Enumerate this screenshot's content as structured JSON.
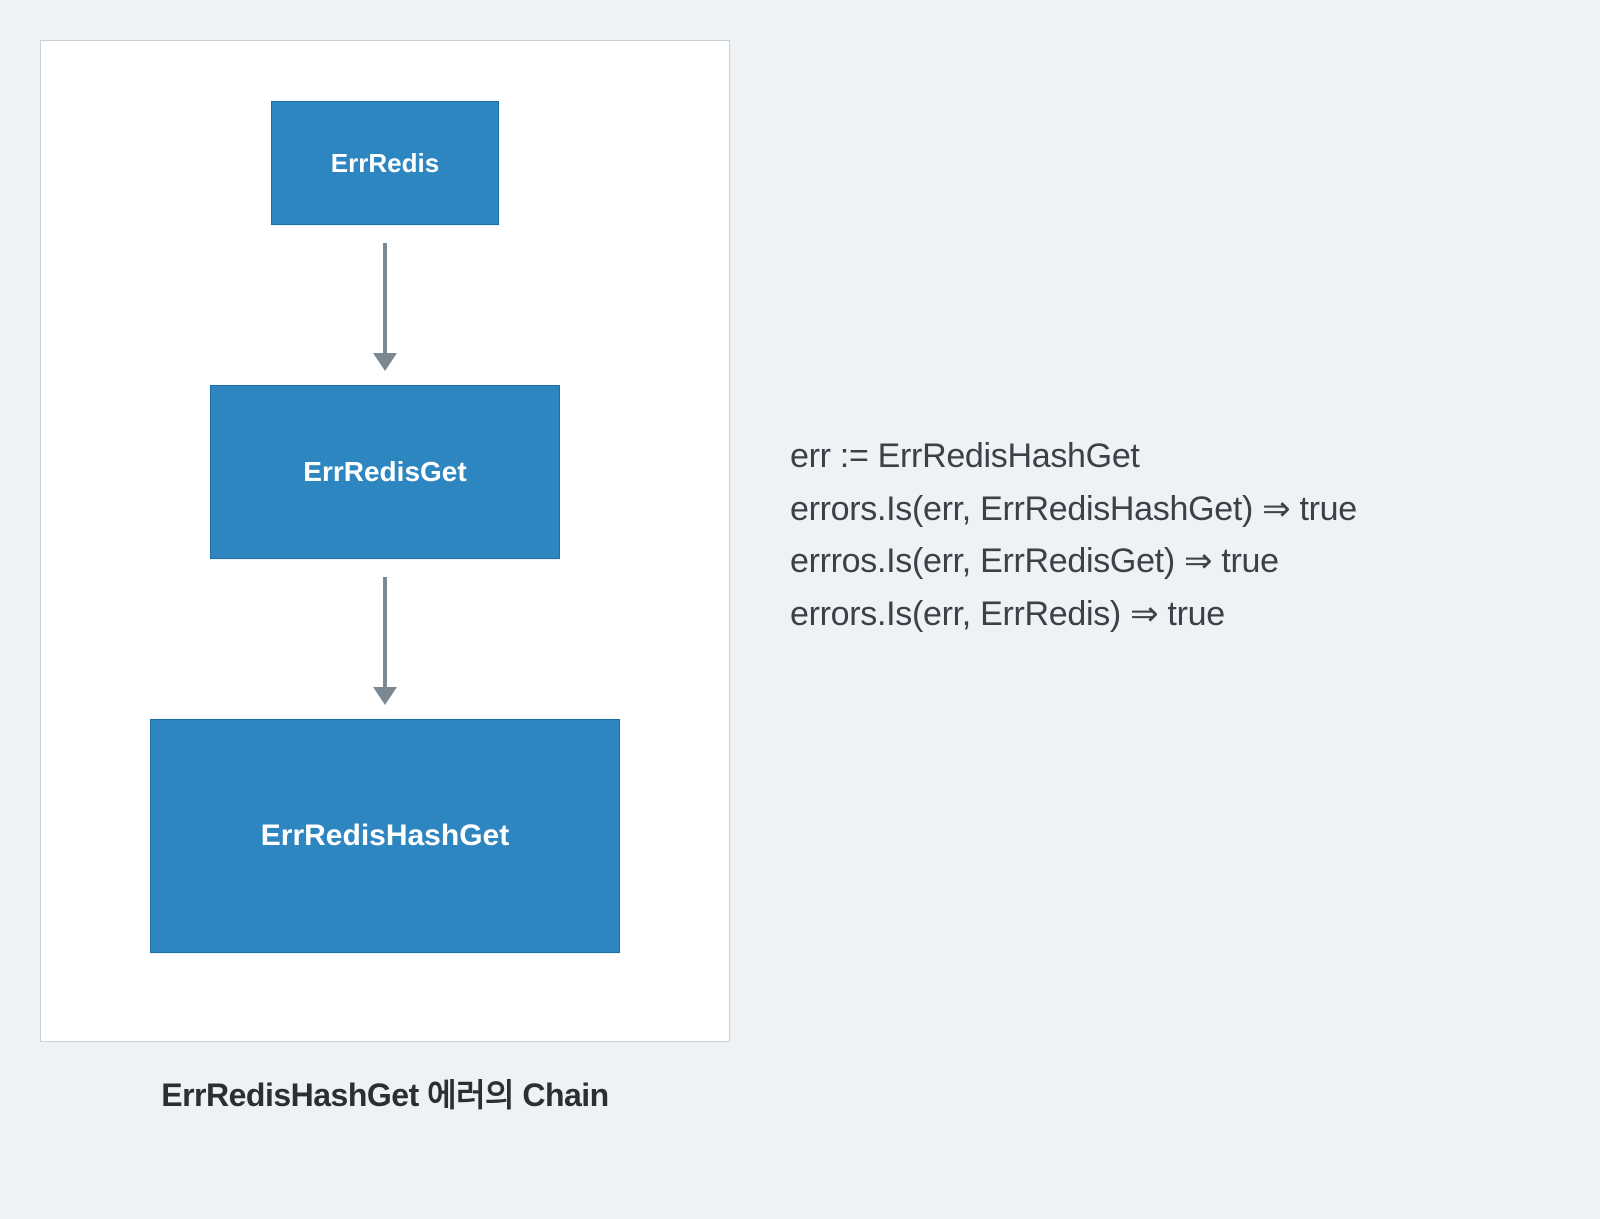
{
  "diagram": {
    "nodes": [
      {
        "label": "ErrRedis"
      },
      {
        "label": "ErrRedisGet"
      },
      {
        "label": "ErrRedisHashGet"
      }
    ],
    "caption": "ErrRedisHashGet 에러의 Chain"
  },
  "code": {
    "lines": [
      "err := ErrRedisHashGet",
      "errors.Is(err, ErrRedisHashGet) ⇒ true",
      "errros.Is(err, ErrRedisGet) ⇒ true",
      "errors.Is(err, ErrRedis) ⇒ true"
    ]
  },
  "colors": {
    "box_fill": "#2e86c1",
    "box_text": "#ffffff",
    "arrow": "#7a8894",
    "page_bg": "#eef2f5",
    "frame_bg": "#ffffff",
    "text": "#3a4148"
  }
}
